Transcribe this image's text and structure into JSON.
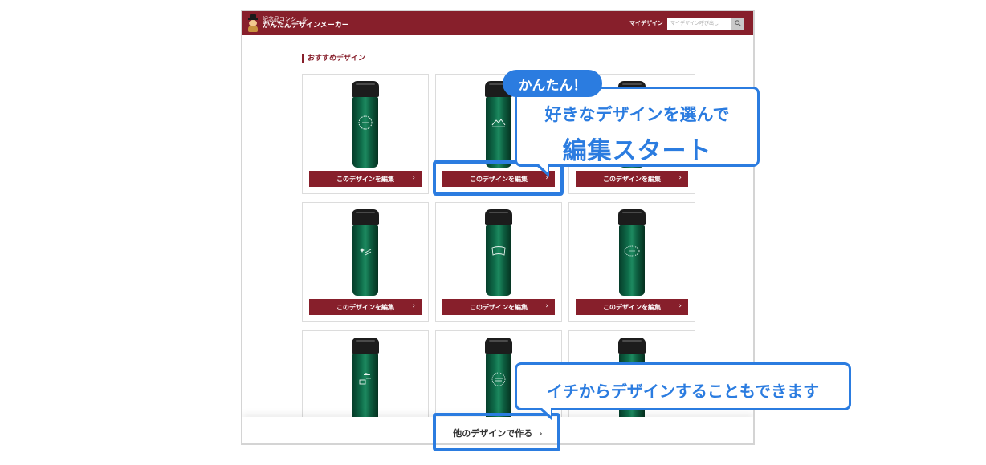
{
  "header": {
    "brand_sub": "記念品コンシェル",
    "brand_main": "かんたんデザインメーカー",
    "mydesign_label": "マイデザイン",
    "search_placeholder": "マイデザイン呼び出し",
    "search_icon": "search-icon",
    "color": "#871f2b"
  },
  "section": {
    "title": "おすすめデザイン"
  },
  "cards": [
    {
      "button_label": "このデザインを編集",
      "art": "wreath-emblem",
      "partially_visible": false
    },
    {
      "button_label": "このデザインを編集",
      "art": "mountain-emblem",
      "partially_visible": false
    },
    {
      "button_label": "このデザインを編集",
      "art": "plain",
      "partially_visible": false
    },
    {
      "button_label": "このデザインを編集",
      "art": "sparkle-text",
      "partially_visible": false
    },
    {
      "button_label": "このデザインを編集",
      "art": "book-outline",
      "partially_visible": false
    },
    {
      "button_label": "このデザインを編集",
      "art": "oval-wreath",
      "partially_visible": false
    },
    {
      "button_label": "",
      "art": "cloud-house",
      "partially_visible": true
    },
    {
      "button_label": "",
      "art": "text-badge",
      "partially_visible": true
    },
    {
      "button_label": "",
      "art": "plain",
      "partially_visible": true
    }
  ],
  "bottom_bar": {
    "other_design_label": "他のデザインで作る"
  },
  "annotations": {
    "easy_tag": "かんたん！",
    "bubble1_line1": "好きなデザインを選んで",
    "bubble1_line2": "編集スタート",
    "bubble2_line1": "イチからデザインすることもできます",
    "accent_color": "#2b7ce0"
  }
}
